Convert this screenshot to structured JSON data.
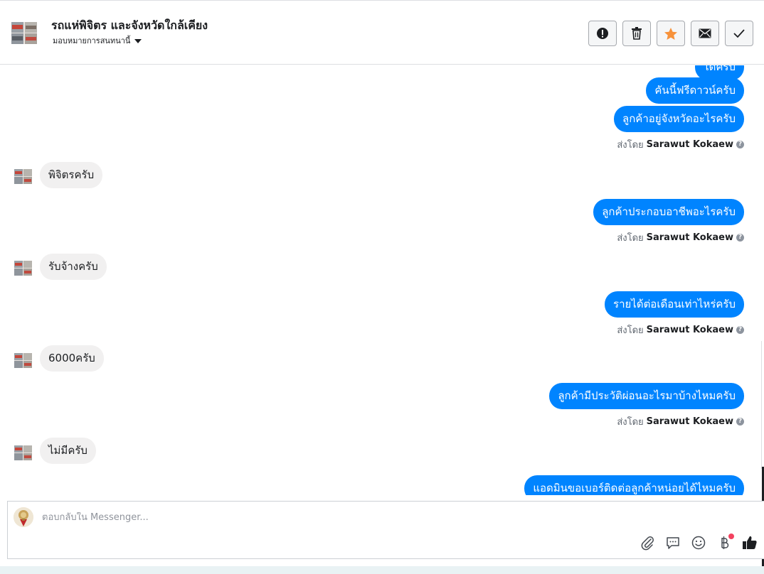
{
  "header": {
    "title": "รถแห่พิจิตร และจังหวัดใกล้เคียง",
    "subtitle": "มอบหมายการสนทนานี้",
    "actions": [
      {
        "name": "alert-icon"
      },
      {
        "name": "trash-icon"
      },
      {
        "name": "star-icon",
        "color": "#f7923b"
      },
      {
        "name": "envelope-icon"
      },
      {
        "name": "check-icon"
      }
    ]
  },
  "conversation": {
    "messages": [
      {
        "direction": "out",
        "text": "ได้ครับ"
      },
      {
        "direction": "out",
        "text": "คันนี้ฟรีดาวน์ครับ"
      },
      {
        "direction": "out",
        "text": "ลูกค้าอยู่จังหวัดอะไรครับ"
      },
      {
        "direction": "in",
        "text": "พิจิตรครับ"
      },
      {
        "direction": "out",
        "text": "ลูกค้าประกอบอาชีพอะไรครับ"
      },
      {
        "direction": "in",
        "text": "รับจ้างครับ"
      },
      {
        "direction": "out",
        "text": "รายได้ต่อเดือนเท่าไหร่ครับ"
      },
      {
        "direction": "in",
        "text": "6000ครับ"
      },
      {
        "direction": "out",
        "text": "ลูกค้ามีประวัติผ่อนอะไรมาบ้างไหมครับ"
      },
      {
        "direction": "in",
        "text": "ไม่มีครับ"
      },
      {
        "direction": "out",
        "text": "แอดมินขอเบอร์ติดต่อลูกค้าหน่อยได้ไหมครับ"
      }
    ],
    "sent_by_prefix": "ส่งโดย",
    "sent_by_name": "Sarawut Kokaew",
    "help_glyph": "?"
  },
  "composer": {
    "placeholder": "ตอบกลับใน Messenger...",
    "tools": [
      "paperclip-icon",
      "chat-bubble-icon",
      "smiley-icon",
      "baht-icon",
      "thumbs-up-icon"
    ],
    "accent": "#0084ff"
  }
}
